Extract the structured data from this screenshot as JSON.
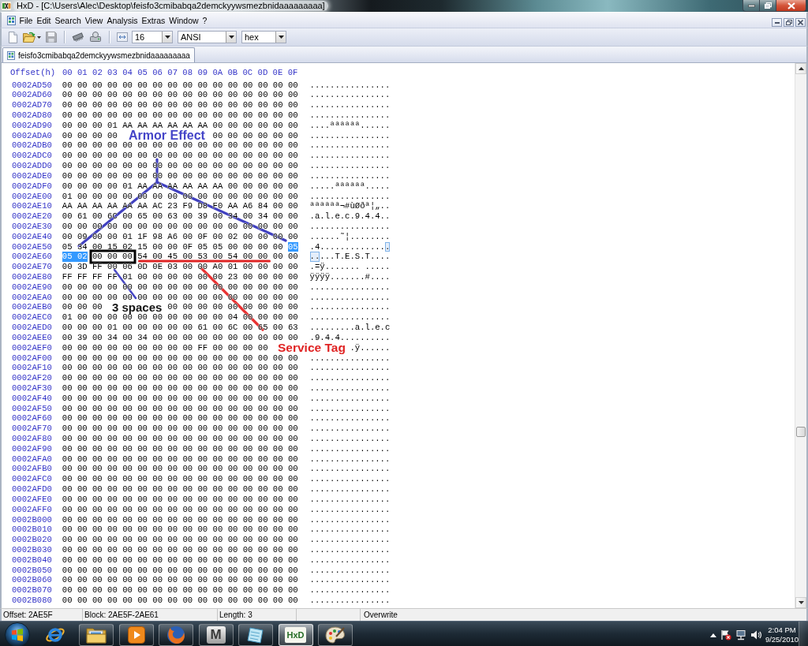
{
  "window": {
    "title": "HxD - [C:\\Users\\Alec\\Desktop\\feisfo3cmibabqa2demckyywsmezbnidaaaaaaaaa]"
  },
  "menu": [
    "File",
    "Edit",
    "Search",
    "View",
    "Analysis",
    "Extras",
    "Window",
    "?"
  ],
  "toolbar": {
    "groups": [
      [
        {
          "kind": "new",
          "disabled": false
        },
        {
          "kind": "open",
          "disabled": false
        },
        {
          "kind": "save",
          "disabled": true
        }
      ],
      [
        {
          "kind": "chip",
          "disabled": false
        },
        {
          "kind": "drive",
          "disabled": false
        }
      ]
    ],
    "dropdowns": [
      "16",
      "ANSI",
      "hex"
    ]
  },
  "tabs": [
    {
      "label": "feisfo3cmibabqa2demckyywsmezbnidaaaaaaaaa",
      "selected": true
    }
  ],
  "hex_view": {
    "header": {
      "offset_label": "Offset(h)",
      "columns": [
        "00",
        "01",
        "02",
        "03",
        "04",
        "05",
        "06",
        "07",
        "08",
        "09",
        "0A",
        "0B",
        "0C",
        "0D",
        "0E",
        "0F"
      ]
    },
    "rows": [
      {
        "offset": "0002AD50",
        "hex": [
          {
            "text": "00 00 00 00 00 00 00 00 00 00 00 00 00 00 00 00",
            "selected": false
          }
        ],
        "ascii": [
          {
            "text": "................",
            "selected": false
          }
        ]
      },
      {
        "offset": "0002AD60",
        "hex": [
          {
            "text": "00 00 00 00 00 00 00 00 00 00 00 00 00 00 00 00",
            "selected": false
          }
        ],
        "ascii": [
          {
            "text": "................",
            "selected": false
          }
        ]
      },
      {
        "offset": "0002AD70",
        "hex": [
          {
            "text": "00 00 00 00 00 00 00 00 00 00 00 00 00 00 00 00",
            "selected": false
          }
        ],
        "ascii": [
          {
            "text": "................",
            "selected": false
          }
        ]
      },
      {
        "offset": "0002AD80",
        "hex": [
          {
            "text": "00 00 00 00 00 00 00 00 00 00 00 00 00 00 00 00",
            "selected": false
          }
        ],
        "ascii": [
          {
            "text": "................",
            "selected": false
          }
        ]
      },
      {
        "offset": "0002AD90",
        "hex": [
          {
            "text": "00 00 00 01 AA AA AA AA AA AA 00 00 00 00 00 00",
            "selected": false
          }
        ],
        "ascii": [
          {
            "text": "....ªªªªªª......",
            "selected": false
          }
        ]
      },
      {
        "offset": "0002ADA0",
        "hex": [
          {
            "text": "00 00 00 00",
            "selected": false
          },
          {
            "text": "00 00 00 00 00 00",
            "selected": false
          }
        ],
        "ascii": [
          {
            "text": "................",
            "selected": false
          }
        ]
      },
      {
        "offset": "0002ADB0",
        "hex": [
          {
            "text": "00 00 00 00 00 00 00 00 00 00 00 00 00 00 00 00",
            "selected": false
          }
        ],
        "ascii": [
          {
            "text": "................",
            "selected": false
          }
        ]
      },
      {
        "offset": "0002ADC0",
        "hex": [
          {
            "text": "00 00 00 00 00 00 00 00 00 00 00 00 00 00 00 00",
            "selected": false
          }
        ],
        "ascii": [
          {
            "text": "................",
            "selected": false
          }
        ]
      },
      {
        "offset": "0002ADD0",
        "hex": [
          {
            "text": "00 00 00 00 00 00 00 00 00 00 00 00 00 00 00 00",
            "selected": false
          }
        ],
        "ascii": [
          {
            "text": "................",
            "selected": false
          }
        ]
      },
      {
        "offset": "0002ADE0",
        "hex": [
          {
            "text": "00 00 00 00 00 00 00 00 00 00 00 00 00 00 00 00",
            "selected": false
          }
        ],
        "ascii": [
          {
            "text": "................",
            "selected": false
          }
        ]
      },
      {
        "offset": "0002ADF0",
        "hex": [
          {
            "text": "00 00 00 00 01 AA AA AA AA AA AA 00 00 00 00 00",
            "selected": false
          }
        ],
        "ascii": [
          {
            "text": ".....ªªªªªª.....",
            "selected": false
          }
        ]
      },
      {
        "offset": "0002AE00",
        "hex": [
          {
            "text": "01 00 00 00 00 00 00 00 00 00 00 00 00 00 00 00",
            "selected": false
          }
        ],
        "ascii": [
          {
            "text": "................",
            "selected": false
          }
        ]
      },
      {
        "offset": "0002AE10",
        "hex": [
          {
            "text": "AA AA AA AA AA AA AC 23 F9 D8 F0 AA A6 84 00 00",
            "selected": false
          }
        ],
        "ascii": [
          {
            "text": "ªªªªªª¬#ùØðª¦„..",
            "selected": false
          }
        ]
      },
      {
        "offset": "0002AE20",
        "hex": [
          {
            "text": "00 61 00 6C 00 65 00 63 00 39 00 34 00 34 00 00",
            "selected": false
          }
        ],
        "ascii": [
          {
            "text": ".a.l.e.c.9.4.4..",
            "selected": false
          }
        ]
      },
      {
        "offset": "0002AE30",
        "hex": [
          {
            "text": "00 00 00 00 00 00 00 00 00 00 00 00 00 00 00 00",
            "selected": false
          }
        ],
        "ascii": [
          {
            "text": "................",
            "selected": false
          }
        ]
      },
      {
        "offset": "0002AE40",
        "hex": [
          {
            "text": "00 09 00 00 01 1F 98 A6 00 0F 00 02 00 00 00 00",
            "selected": false
          }
        ],
        "ascii": [
          {
            "text": "......˜¦........",
            "selected": false
          }
        ]
      },
      {
        "offset": "0002AE50",
        "hex": [
          {
            "text": "05 34 00 15 02 15 00 00 0F 05 05 00 00 00 00",
            "selected": false
          },
          {
            "text": "05",
            "selected": true
          }
        ],
        "ascii": [
          {
            "text": ".4.............",
            "selected": false
          },
          {
            "text": ".",
            "selected": true
          }
        ]
      },
      {
        "offset": "0002AE60",
        "hex": [
          {
            "text": "05 02",
            "selected": true
          },
          {
            "text": "00 00 00 54 00 45 00 53 00 54 00 00 00 00",
            "selected": false
          }
        ],
        "ascii": [
          {
            "text": "..",
            "selected": true
          },
          {
            "text": "...T.E.S.T....",
            "selected": false
          }
        ]
      },
      {
        "offset": "0002AE70",
        "hex": [
          {
            "text": "00 3D FF 00 06 0D 0E 03 00 00 A0 01 00 00 00 00",
            "selected": false
          }
        ],
        "ascii": [
          {
            "text": ".=ÿ....... .....",
            "selected": false
          }
        ]
      },
      {
        "offset": "0002AE80",
        "hex": [
          {
            "text": "FF FF FF FF 01 00 00 00 00 00 00 23 00 00 00 00",
            "selected": false
          }
        ],
        "ascii": [
          {
            "text": "ÿÿÿÿ.......#....",
            "selected": false
          }
        ]
      },
      {
        "offset": "0002AE90",
        "hex": [
          {
            "text": "00 00 00 00 00 00 00 00 00 00 00 00 00 00 00 00",
            "selected": false
          }
        ],
        "ascii": [
          {
            "text": "................",
            "selected": false
          }
        ]
      },
      {
        "offset": "0002AEA0",
        "hex": [
          {
            "text": "00 00 00 00 00 00 00 00 00 00 00 00 00 00 00 00",
            "selected": false
          }
        ],
        "ascii": [
          {
            "text": "................",
            "selected": false
          }
        ]
      },
      {
        "offset": "0002AEB0",
        "hex": [
          {
            "text": "00 00 00",
            "selected": false
          },
          {
            "text": "00 00 00 00 00 00 00 00 00",
            "selected": false
          }
        ],
        "ascii": [
          {
            "text": "................",
            "selected": false
          }
        ]
      },
      {
        "offset": "0002AEC0",
        "hex": [
          {
            "text": "01 00 00 00 00 00 00 00 00 00 00 04 00 00 00 00",
            "selected": false
          }
        ],
        "ascii": [
          {
            "text": "................",
            "selected": false
          }
        ]
      },
      {
        "offset": "0002AED0",
        "hex": [
          {
            "text": "00 00 00 01 00 00 00 00 00 61 00 6C 00 65 00 63",
            "selected": false
          }
        ],
        "ascii": [
          {
            "text": ".........a.l.e.c",
            "selected": false
          }
        ]
      },
      {
        "offset": "0002AEE0",
        "hex": [
          {
            "text": "00 39 00 34 00 34 00 00 00 00 00 00 00 00 00 00",
            "selected": false
          }
        ],
        "ascii": [
          {
            "text": ".9.4.4..........",
            "selected": false
          }
        ]
      },
      {
        "offset": "0002AEF0",
        "hex": [
          {
            "text": "00 00 00 00 00 00 00 00 00 FF 00 00 00 00",
            "selected": false
          }
        ],
        "ascii": [
          {
            "text": ".ÿ......",
            "selected": false
          }
        ]
      },
      {
        "offset": "0002AF00",
        "hex": [
          {
            "text": "00 00 00 00 00 00 00 00 00 00 00 00 00 00 00 00",
            "selected": false
          }
        ],
        "ascii": [
          {
            "text": "................",
            "selected": false
          }
        ]
      },
      {
        "offset": "0002AF10",
        "hex": [
          {
            "text": "00 00 00 00 00 00 00 00 00 00 00 00 00 00 00 00",
            "selected": false
          }
        ],
        "ascii": [
          {
            "text": "................",
            "selected": false
          }
        ]
      },
      {
        "offset": "0002AF20",
        "hex": [
          {
            "text": "00 00 00 00 00 00 00 00 00 00 00 00 00 00 00 00",
            "selected": false
          }
        ],
        "ascii": [
          {
            "text": "................",
            "selected": false
          }
        ]
      },
      {
        "offset": "0002AF30",
        "hex": [
          {
            "text": "00 00 00 00 00 00 00 00 00 00 00 00 00 00 00 00",
            "selected": false
          }
        ],
        "ascii": [
          {
            "text": "................",
            "selected": false
          }
        ]
      },
      {
        "offset": "0002AF40",
        "hex": [
          {
            "text": "00 00 00 00 00 00 00 00 00 00 00 00 00 00 00 00",
            "selected": false
          }
        ],
        "ascii": [
          {
            "text": "................",
            "selected": false
          }
        ]
      },
      {
        "offset": "0002AF50",
        "hex": [
          {
            "text": "00 00 00 00 00 00 00 00 00 00 00 00 00 00 00 00",
            "selected": false
          }
        ],
        "ascii": [
          {
            "text": "................",
            "selected": false
          }
        ]
      },
      {
        "offset": "0002AF60",
        "hex": [
          {
            "text": "00 00 00 00 00 00 00 00 00 00 00 00 00 00 00 00",
            "selected": false
          }
        ],
        "ascii": [
          {
            "text": "................",
            "selected": false
          }
        ]
      },
      {
        "offset": "0002AF70",
        "hex": [
          {
            "text": "00 00 00 00 00 00 00 00 00 00 00 00 00 00 00 00",
            "selected": false
          }
        ],
        "ascii": [
          {
            "text": "................",
            "selected": false
          }
        ]
      },
      {
        "offset": "0002AF80",
        "hex": [
          {
            "text": "00 00 00 00 00 00 00 00 00 00 00 00 00 00 00 00",
            "selected": false
          }
        ],
        "ascii": [
          {
            "text": "................",
            "selected": false
          }
        ]
      },
      {
        "offset": "0002AF90",
        "hex": [
          {
            "text": "00 00 00 00 00 00 00 00 00 00 00 00 00 00 00 00",
            "selected": false
          }
        ],
        "ascii": [
          {
            "text": "................",
            "selected": false
          }
        ]
      },
      {
        "offset": "0002AFA0",
        "hex": [
          {
            "text": "00 00 00 00 00 00 00 00 00 00 00 00 00 00 00 00",
            "selected": false
          }
        ],
        "ascii": [
          {
            "text": "................",
            "selected": false
          }
        ]
      },
      {
        "offset": "0002AFB0",
        "hex": [
          {
            "text": "00 00 00 00 00 00 00 00 00 00 00 00 00 00 00 00",
            "selected": false
          }
        ],
        "ascii": [
          {
            "text": "................",
            "selected": false
          }
        ]
      },
      {
        "offset": "0002AFC0",
        "hex": [
          {
            "text": "00 00 00 00 00 00 00 00 00 00 00 00 00 00 00 00",
            "selected": false
          }
        ],
        "ascii": [
          {
            "text": "................",
            "selected": false
          }
        ]
      },
      {
        "offset": "0002AFD0",
        "hex": [
          {
            "text": "00 00 00 00 00 00 00 00 00 00 00 00 00 00 00 00",
            "selected": false
          }
        ],
        "ascii": [
          {
            "text": "................",
            "selected": false
          }
        ]
      },
      {
        "offset": "0002AFE0",
        "hex": [
          {
            "text": "00 00 00 00 00 00 00 00 00 00 00 00 00 00 00 00",
            "selected": false
          }
        ],
        "ascii": [
          {
            "text": "................",
            "selected": false
          }
        ]
      },
      {
        "offset": "0002AFF0",
        "hex": [
          {
            "text": "00 00 00 00 00 00 00 00 00 00 00 00 00 00 00 00",
            "selected": false
          }
        ],
        "ascii": [
          {
            "text": "................",
            "selected": false
          }
        ]
      },
      {
        "offset": "0002B000",
        "hex": [
          {
            "text": "00 00 00 00 00 00 00 00 00 00 00 00 00 00 00 00",
            "selected": false
          }
        ],
        "ascii": [
          {
            "text": "................",
            "selected": false
          }
        ]
      },
      {
        "offset": "0002B010",
        "hex": [
          {
            "text": "00 00 00 00 00 00 00 00 00 00 00 00 00 00 00 00",
            "selected": false
          }
        ],
        "ascii": [
          {
            "text": "................",
            "selected": false
          }
        ]
      },
      {
        "offset": "0002B020",
        "hex": [
          {
            "text": "00 00 00 00 00 00 00 00 00 00 00 00 00 00 00 00",
            "selected": false
          }
        ],
        "ascii": [
          {
            "text": "................",
            "selected": false
          }
        ]
      },
      {
        "offset": "0002B030",
        "hex": [
          {
            "text": "00 00 00 00 00 00 00 00 00 00 00 00 00 00 00 00",
            "selected": false
          }
        ],
        "ascii": [
          {
            "text": "................",
            "selected": false
          }
        ]
      },
      {
        "offset": "0002B040",
        "hex": [
          {
            "text": "00 00 00 00 00 00 00 00 00 00 00 00 00 00 00 00",
            "selected": false
          }
        ],
        "ascii": [
          {
            "text": "................",
            "selected": false
          }
        ]
      },
      {
        "offset": "0002B050",
        "hex": [
          {
            "text": "00 00 00 00 00 00 00 00 00 00 00 00 00 00 00 00",
            "selected": false
          }
        ],
        "ascii": [
          {
            "text": "................",
            "selected": false
          }
        ]
      },
      {
        "offset": "0002B060",
        "hex": [
          {
            "text": "00 00 00 00 00 00 00 00 00 00 00 00 00 00 00 00",
            "selected": false
          }
        ],
        "ascii": [
          {
            "text": "................",
            "selected": false
          }
        ]
      },
      {
        "offset": "0002B070",
        "hex": [
          {
            "text": "00 00 00 00 00 00 00 00 00 00 00 00 00 00 00 00",
            "selected": false
          }
        ],
        "ascii": [
          {
            "text": "................",
            "selected": false
          }
        ]
      },
      {
        "offset": "0002B080",
        "hex": [
          {
            "text": "00 00 00 00 00 00 00 00 00 00 00 00 00 00 00 00",
            "selected": false
          }
        ],
        "ascii": [
          {
            "text": "................",
            "selected": false
          }
        ]
      }
    ]
  },
  "annotations": {
    "labels": [
      {
        "text": "Armor Effect",
        "color": "#4444c8"
      },
      {
        "text": "3 spaces",
        "color": "#141414"
      },
      {
        "text": "Service Tag",
        "color": "#e02424"
      }
    ],
    "marks": [
      {
        "kind": "branch",
        "color": "#4040c0"
      },
      {
        "kind": "box",
        "color": "#000000"
      },
      {
        "kind": "leader",
        "color": "#4646c4"
      },
      {
        "kind": "underline",
        "color": "#e02424"
      },
      {
        "kind": "leader",
        "color": "#e83030"
      }
    ]
  },
  "status_bar": [
    "Offset: 2AE5F",
    "Block: 2AE5F-2AE61",
    "Length: 3",
    "Overwrite"
  ],
  "taskbar": {
    "buttons": [
      {
        "kind": "browser",
        "running": false,
        "selected": false
      },
      {
        "kind": "folder",
        "running": true,
        "selected": false
      },
      {
        "kind": "player",
        "running": true,
        "selected": false
      },
      {
        "kind": "fox",
        "running": true,
        "selected": false
      },
      {
        "kind": "letter",
        "text": "M",
        "running": true,
        "selected": false
      },
      {
        "kind": "sheet",
        "running": true,
        "selected": false
      },
      {
        "kind": "logo",
        "text": "HxD",
        "running": true,
        "selected": true
      },
      {
        "kind": "palette",
        "running": true,
        "selected": false
      }
    ],
    "clock": {
      "time": "2:04 PM",
      "date": "9/25/2010"
    }
  }
}
